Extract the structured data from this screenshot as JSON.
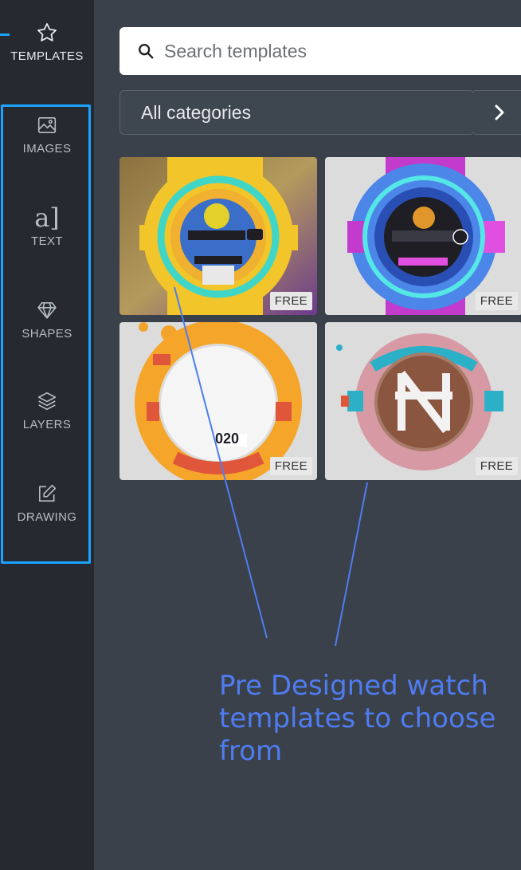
{
  "sidebar": {
    "items": [
      {
        "label": "TEMPLATES",
        "icon": "star-icon"
      },
      {
        "label": "IMAGES",
        "icon": "image-icon"
      },
      {
        "label": "TEXT",
        "icon": "text-icon",
        "glyph": "a]"
      },
      {
        "label": "SHAPES",
        "icon": "diamond-icon"
      },
      {
        "label": "LAYERS",
        "icon": "layers-icon"
      },
      {
        "label": "DRAWING",
        "icon": "edit-icon"
      }
    ],
    "highlight_color": "#1aa3ff"
  },
  "search": {
    "placeholder": "Search templates",
    "value": ""
  },
  "category": {
    "selected": "All categories"
  },
  "templates": [
    {
      "badge": "FREE"
    },
    {
      "badge": "FREE"
    },
    {
      "badge": "FREE"
    },
    {
      "badge": "FREE"
    }
  ],
  "annotation": {
    "text": "Pre Designed watch\ntemplates to choose\nfrom",
    "color": "#4f7cf0"
  }
}
